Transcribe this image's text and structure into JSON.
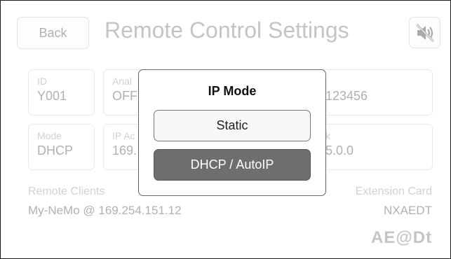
{
  "header": {
    "back_label": "Back",
    "title": "Remote Control Settings",
    "mute_icon": "speaker-muted-icon"
  },
  "fields": {
    "id": {
      "label": "ID",
      "value": "Y001"
    },
    "analog": {
      "label": "Anal",
      "value": "OFF"
    },
    "serial": {
      "value": "123456"
    },
    "mode": {
      "label": "Mode",
      "value": "DHCP"
    },
    "ip": {
      "label": "IP Ac",
      "value": "169."
    },
    "mask": {
      "label": "k",
      "value": "5.0.0"
    }
  },
  "remote_clients": {
    "label": "Remote Clients",
    "value": "My-NeMo @ 169.254.151.12"
  },
  "extension_card": {
    "label": "Extension Card",
    "value": "NXAEDT"
  },
  "logo_text": "AE@Dt",
  "dialog": {
    "title": "IP Mode",
    "options": [
      {
        "label": "Static",
        "selected": false
      },
      {
        "label": "DHCP / AutoIP",
        "selected": true
      }
    ]
  }
}
